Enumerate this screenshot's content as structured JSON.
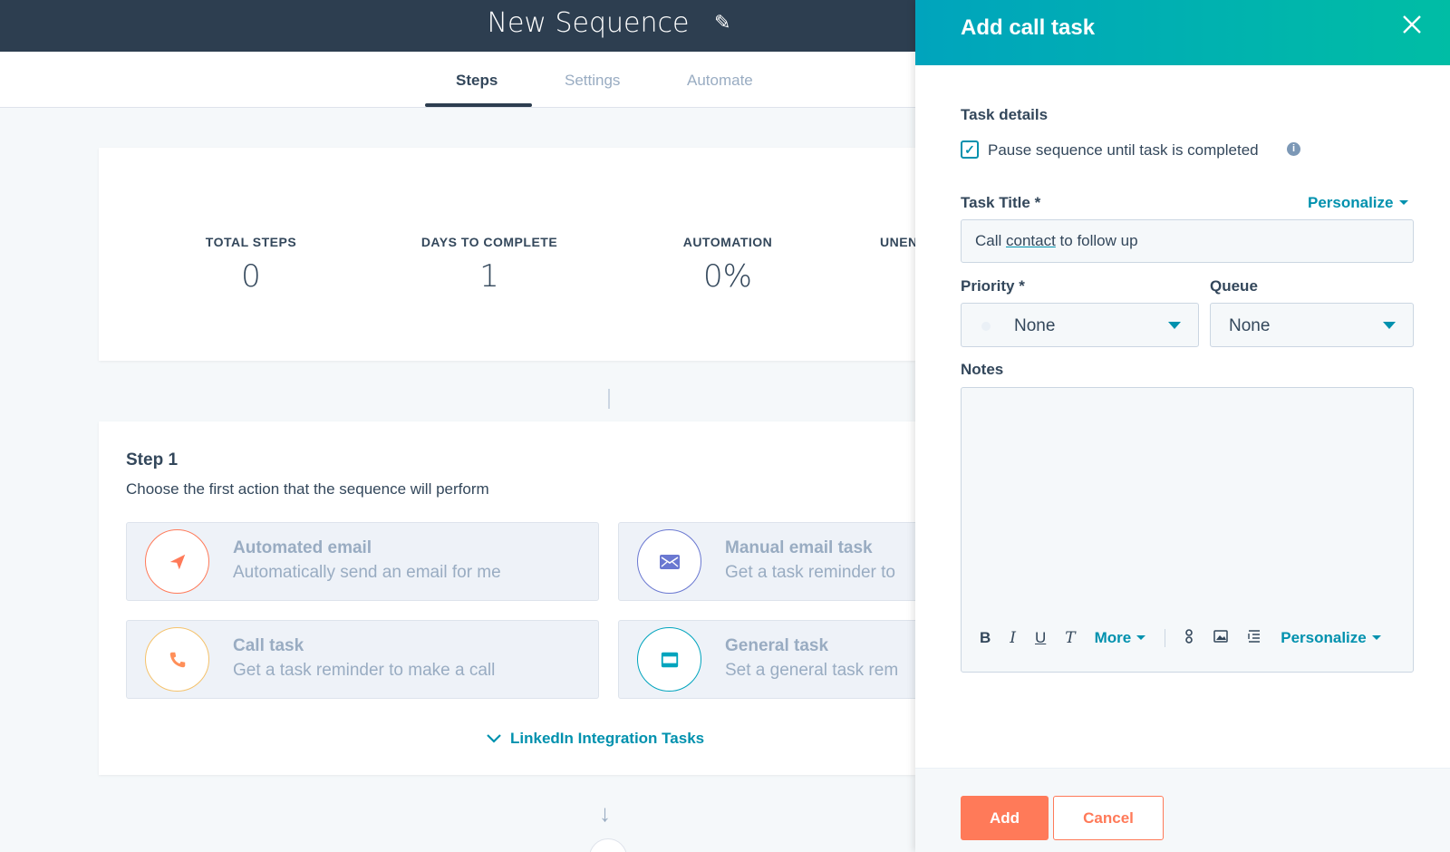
{
  "header": {
    "title": "New Sequence",
    "edit_icon": "pencil-icon"
  },
  "tabs": [
    {
      "label": "Steps",
      "active": true
    },
    {
      "label": "Settings",
      "active": false
    },
    {
      "label": "Automate",
      "active": false
    }
  ],
  "stats": [
    {
      "label": "TOTAL STEPS",
      "value": "0"
    },
    {
      "label": "DAYS TO COMPLETE",
      "value": "1"
    },
    {
      "label": "AUTOMATION",
      "value": "0%"
    },
    {
      "label": "UNEN",
      "value": ""
    }
  ],
  "step": {
    "title": "Step 1",
    "description": "Choose the first action that the sequence will perform",
    "actions": [
      {
        "title": "Automated email",
        "subtitle": "Automatically send an email for me",
        "icon": "send-icon",
        "color": "#ff7a59"
      },
      {
        "title": "Manual email task",
        "subtitle": "Get a task reminder to",
        "icon": "envelope-icon",
        "color": "#6a78d1"
      },
      {
        "title": "Call task",
        "subtitle": "Get a task reminder to make a call",
        "icon": "phone-icon",
        "color": "#f5c26b"
      },
      {
        "title": "General task",
        "subtitle": "Set a general task rem",
        "icon": "calendar-icon",
        "color": "#00a4bd"
      }
    ],
    "linkedin_label": "LinkedIn Integration Tasks"
  },
  "panel": {
    "title": "Add call task",
    "task_details_label": "Task details",
    "pause_checkbox": {
      "label": "Pause sequence until task is completed",
      "checked": true
    },
    "task_title_label": "Task Title *",
    "personalize_label": "Personalize",
    "task_title_value": {
      "before": "Call ",
      "token": "contact",
      "after": " to follow up"
    },
    "priority_label": "Priority *",
    "priority_value": "None",
    "queue_label": "Queue",
    "queue_value": "None",
    "notes_label": "Notes",
    "toolbar": {
      "bold": "B",
      "italic": "I",
      "underline": "U",
      "clear": "T",
      "more": "More",
      "personalize": "Personalize"
    },
    "add_button": "Add",
    "cancel_button": "Cancel"
  },
  "colors": {
    "header_bg": "#2d3e50",
    "accent": "#0091ae",
    "primary_button": "#ff7a59"
  }
}
